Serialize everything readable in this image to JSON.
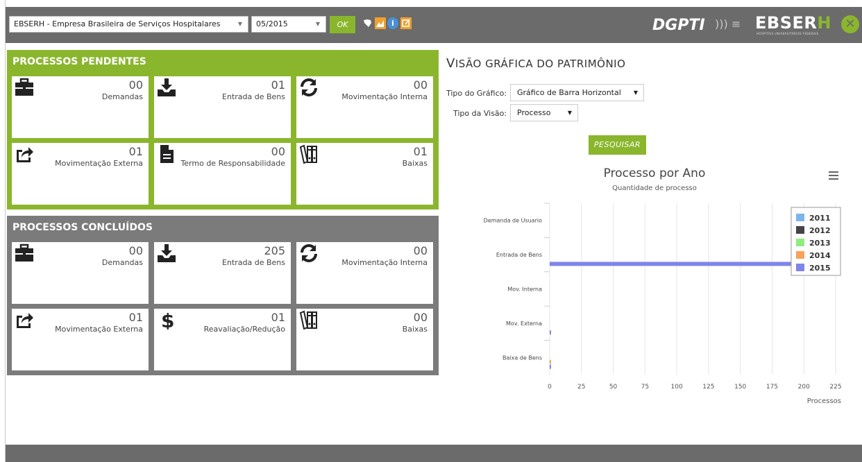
{
  "topbar": {
    "company_select": "EBSERH - Empresa Brasileira de Serviços Hospitalares",
    "period_select": "05/2015",
    "ok_label": "OK",
    "brand_dgpti": "DGPTI",
    "brand_ebserh_main": "EBSER",
    "brand_ebserh_h": "H",
    "brand_sub": "HOSPITAIS UNIVERSITÁRIOS FEDERAIS"
  },
  "pending": {
    "title": "PROCESSOS PENDENTES",
    "tiles": [
      {
        "num": "00",
        "label": "Demandas",
        "icon": "briefcase-icon"
      },
      {
        "num": "01",
        "label": "Entrada de Bens",
        "icon": "inbox-download-icon"
      },
      {
        "num": "00",
        "label": "Movimentação Interna",
        "icon": "refresh-icon"
      },
      {
        "num": "01",
        "label": "Movimentação Externa",
        "icon": "share-icon"
      },
      {
        "num": "00",
        "label": "Termo de Responsabilidade",
        "icon": "document-icon"
      },
      {
        "num": "01",
        "label": "Baixas",
        "icon": "archive-icon"
      }
    ]
  },
  "done": {
    "title": "PROCESSOS CONCLUÍDOS",
    "tiles": [
      {
        "num": "00",
        "label": "Demandas",
        "icon": "briefcase-icon"
      },
      {
        "num": "205",
        "label": "Entrada de Bens",
        "icon": "inbox-download-icon"
      },
      {
        "num": "00",
        "label": "Movimentação Interna",
        "icon": "refresh-icon"
      },
      {
        "num": "01",
        "label": "Movimentação Externa",
        "icon": "share-icon"
      },
      {
        "num": "01",
        "label": "Reavaliação/Redução",
        "icon": "dollar-icon"
      },
      {
        "num": "00",
        "label": "Baixas",
        "icon": "archive-icon"
      }
    ]
  },
  "main": {
    "title_cap": "V",
    "title_rest": "ISÃO GRÁFICA DO PATRIMÔNIO",
    "chart_type_label": "Tipo do Gráfico:",
    "chart_type_value": "Gráfico de Barra Horizontal",
    "view_type_label": "Tipo da Visão:",
    "view_type_value": "Processo",
    "search_label": "PESQUISAR"
  },
  "chart_data": {
    "type": "bar",
    "orientation": "horizontal",
    "title": "Processo por Ano",
    "subtitle": "Quantidade de processo",
    "xlabel": "Processos",
    "categories": [
      "Demanda de Usuario",
      "Entrada de Bens",
      "Mov. Interna",
      "Mov. Externa",
      "Baixa de Bens"
    ],
    "xlim": [
      0,
      225
    ],
    "xticks": [
      0,
      25,
      50,
      75,
      100,
      125,
      150,
      175,
      200,
      225
    ],
    "legend_position": "top-right",
    "series": [
      {
        "name": "2011",
        "color": "#7cb5ec",
        "values": [
          0,
          0,
          0,
          0,
          0
        ]
      },
      {
        "name": "2012",
        "color": "#434348",
        "values": [
          0,
          0,
          0,
          0,
          0
        ]
      },
      {
        "name": "2013",
        "color": "#90ed7d",
        "values": [
          0,
          0,
          0,
          0,
          0
        ]
      },
      {
        "name": "2014",
        "color": "#f7a35c",
        "values": [
          0,
          0,
          0,
          0,
          1
        ]
      },
      {
        "name": "2015",
        "color": "#8085e9",
        "values": [
          0,
          206,
          0,
          1,
          1
        ]
      }
    ]
  }
}
